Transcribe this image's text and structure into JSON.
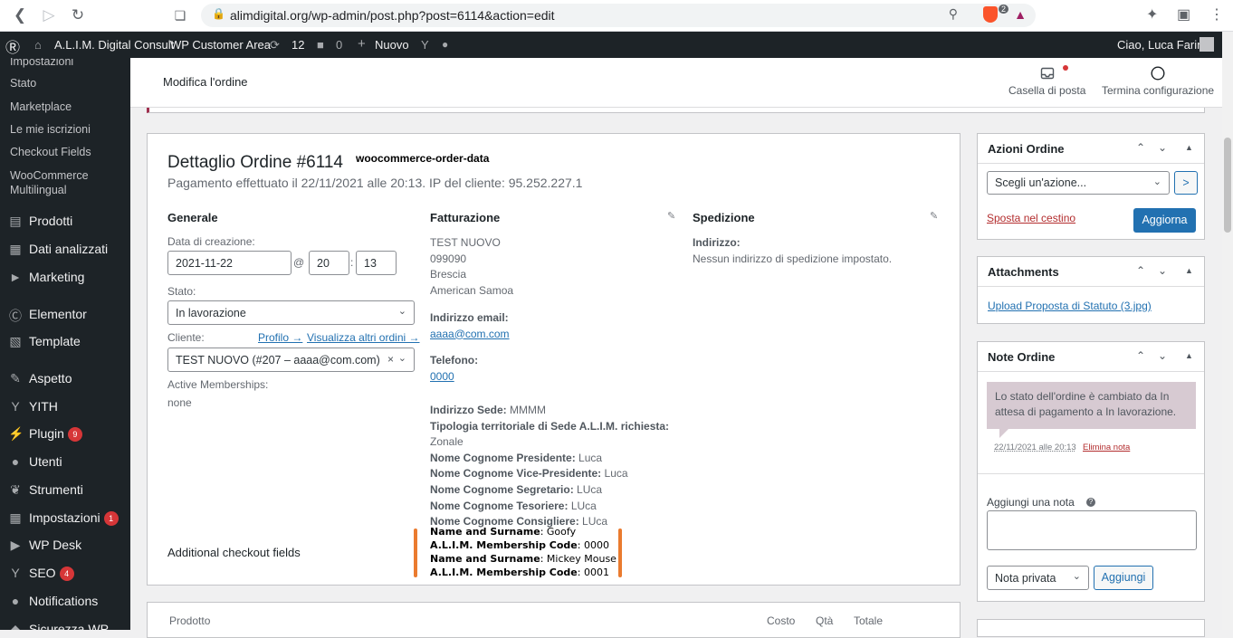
{
  "browser": {
    "url": "alimdigital.org/wp-admin/post.php?post=6114&action=edit",
    "brave_badge": "2"
  },
  "adminbar": {
    "site_name": "A.L.I.M. Digital Consult",
    "customer_area": "WP Customer Area",
    "updates_count": "12",
    "comments_count": "0",
    "new_label": "Nuovo",
    "greeting": "Ciao, Luca Farina"
  },
  "sidebar": {
    "submenu": [
      "Impostazioni",
      "Stato",
      "Marketplace",
      "Le mie iscrizioni",
      "Checkout Fields",
      "WooCommerce",
      "Multilingual"
    ],
    "menu": [
      {
        "label": "Prodotti",
        "icon": "archive-icon"
      },
      {
        "label": "Dati analizzati",
        "icon": "chart-bar-icon"
      },
      {
        "label": "Marketing",
        "icon": "megaphone-icon"
      },
      {
        "label": "Elementor",
        "icon": "elementor-icon"
      },
      {
        "label": "Template",
        "icon": "folder-icon"
      },
      {
        "label": "Aspetto",
        "icon": "paintbrush-icon"
      },
      {
        "label": "YITH",
        "icon": "yith-icon"
      },
      {
        "label": "Plugin",
        "icon": "plug-icon",
        "badge": "9"
      },
      {
        "label": "Utenti",
        "icon": "user-icon"
      },
      {
        "label": "Strumenti",
        "icon": "wrench-icon"
      },
      {
        "label": "Impostazioni",
        "icon": "settings-icon",
        "badge": "1"
      },
      {
        "label": "WP Desk",
        "icon": "play-icon"
      },
      {
        "label": "SEO",
        "icon": "yoast-icon",
        "badge": "4"
      },
      {
        "label": "Notifications",
        "icon": "bell-icon"
      },
      {
        "label": "Sicurezza WP",
        "icon": "shield-icon"
      }
    ]
  },
  "header": {
    "title": "Modifica l'ordine",
    "inbox_label": "Casella di posta",
    "finish_setup_label": "Termina configurazione"
  },
  "order": {
    "title": "Dettaglio Ordine #6114",
    "tag": "woocommerce-order-data",
    "payment_info": "Pagamento effettuato il 22/11/2021 alle 20:13. IP del cliente: 95.252.227.1",
    "general": {
      "heading": "Generale",
      "created_label": "Data di creazione:",
      "date": "2021-11-22",
      "at": "@",
      "hour": "20",
      "colon": ":",
      "minute": "13",
      "status_label": "Stato:",
      "status": "In lavorazione",
      "customer_label": "Cliente:",
      "profile_link": "Profilo →",
      "other_orders_link": "Visualizza altri ordini →",
      "customer": "TEST NUOVO (#207 – aaaa@com.com)",
      "memberships_label": "Active Memberships:",
      "memberships_value": "none"
    },
    "billing": {
      "heading": "Fatturazione",
      "address": [
        "TEST NUOVO",
        "099090",
        "Brescia",
        "American Samoa"
      ],
      "email_label": "Indirizzo email:",
      "email": "aaaa@com.com",
      "phone_label": "Telefono:",
      "phone": "0000",
      "fields": [
        {
          "label": "Indirizzo Sede:",
          "value": "MMMM"
        },
        {
          "label": "Tipologia territoriale di Sede A.L.I.M. richiesta:",
          "value": ""
        },
        {
          "label": "",
          "value": "Zonale"
        },
        {
          "label": "Nome Cognome Presidente:",
          "value": "Luca"
        },
        {
          "label": "Nome Cognome Vice-Presidente:",
          "value": "Luca"
        },
        {
          "label": "Nome Cognome Segretario:",
          "value": "LUca"
        },
        {
          "label": "Nome Cognome Tesoriere:",
          "value": "LUca"
        },
        {
          "label": "Nome Cognome Consigliere:",
          "value": "LUca"
        }
      ]
    },
    "shipping": {
      "heading": "Spedizione",
      "address_label": "Indirizzo:",
      "address_value": "Nessun indirizzo di spedizione impostato."
    },
    "additional": {
      "heading": "Additional checkout fields",
      "lines": [
        {
          "label": "Name and Surname",
          "value": ": Goofy"
        },
        {
          "label": "A.L.I.M. Membership Code",
          "value": ": 0000"
        },
        {
          "label": "Name and Surname",
          "value": ": Mickey Mouse"
        },
        {
          "label": "A.L.I.M. Membership Code",
          "value": ": 0001"
        }
      ]
    }
  },
  "items_table": {
    "headers": [
      "Prodotto",
      "Costo",
      "Qtà",
      "Totale"
    ]
  },
  "actions_box": {
    "title": "Azioni Ordine",
    "select": "Scegli un'azione...",
    "go": ">",
    "trash_link": "Sposta nel cestino",
    "update_button": "Aggiorna"
  },
  "attachments_box": {
    "title": "Attachments",
    "link": "Upload Proposta di Statuto (3.jpg)"
  },
  "notes_box": {
    "title": "Note Ordine",
    "note_text": "Lo stato dell'ordine è cambiato da In attesa di pagamento a In lavorazione.",
    "note_date": "22/11/2021 alle 20:13",
    "delete_link": "Elimina nota",
    "add_label": "Aggiungi una nota",
    "help": "?",
    "note_type": "Nota privata",
    "add_button": "Aggiungi"
  }
}
